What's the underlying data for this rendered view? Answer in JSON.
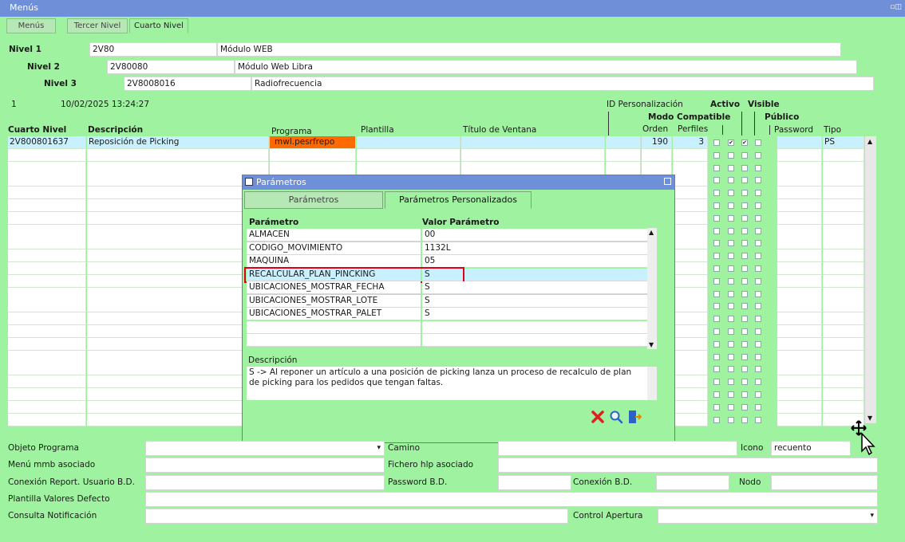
{
  "window": {
    "title": "Menús",
    "controls": "▫◫"
  },
  "tabs": [
    "Menús",
    "Tercer Nivel",
    "Cuarto Nivel"
  ],
  "levels": [
    {
      "label": "Nivel 1",
      "code": "2V80",
      "name": "Módulo WEB"
    },
    {
      "label": "Nivel 2",
      "code": "2V80080",
      "name": "Módulo Web Libra"
    },
    {
      "label": "Nivel 3",
      "code": "2V8008016",
      "name": "Radiofrecuencia"
    }
  ],
  "record": {
    "number": "1",
    "datetime": "10/02/2025 13:24:27"
  },
  "headers": {
    "cuarto_nivel": "Cuarto Nivel",
    "descripcion": "Descripción",
    "programa": "Programa",
    "plantilla": "Plantilla",
    "titulo_ventana": "Título de Ventana",
    "id_personalizacion": "ID Personalización",
    "modo_compatible": "Modo Compatible",
    "orden": "Orden",
    "perfiles": "Perfiles",
    "activo": "Activo",
    "visible": "Visible",
    "publico": "Público",
    "password": "Password",
    "tipo": "Tipo"
  },
  "rows": [
    {
      "cuarto_nivel": "2V800801637",
      "descripcion": "Reposición de Picking",
      "programa": "mwl.pesrfrepo",
      "orden": "190",
      "perfiles": "3",
      "checks": [
        "",
        "✔",
        "✔",
        ""
      ],
      "tipo": "PS"
    }
  ],
  "dialog": {
    "title": "Parámetros",
    "tabs": [
      "Parámetros",
      "Parámetros Personalizados"
    ],
    "col_param": "Parámetro",
    "col_value": "Valor Parámetro",
    "params": [
      {
        "name": "ALMACEN",
        "value": "00"
      },
      {
        "name": "CODIGO_MOVIMIENTO",
        "value": "1132L"
      },
      {
        "name": "MAQUINA",
        "value": "05"
      },
      {
        "name": "RECALCULAR_PLAN_PINCKING",
        "value": "S"
      },
      {
        "name": "UBICACIONES_MOSTRAR_FECHA",
        "value": "S"
      },
      {
        "name": "UBICACIONES_MOSTRAR_LOTE",
        "value": "S"
      },
      {
        "name": "UBICACIONES_MOSTRAR_PALET",
        "value": "S"
      }
    ],
    "selected_index": 3,
    "desc_label": "Descripción",
    "description": "S -> Al reponer un artículo a una posición de picking lanza un proceso de recalculo de plan de picking para los pedidos que tengan faltas."
  },
  "form": {
    "objeto_programa": "Objeto Programa",
    "camino": "Camino",
    "icono": "Icono",
    "icono_value": "recuento",
    "menu_mmb": "Menú mmb asociado",
    "fichero_hlp": "Fichero hlp asociado",
    "conexion_report": "Conexión Report. Usuario B.D.",
    "password_bd": "Password B.D.",
    "conexion_bd": "Conexión B.D.",
    "nodo": "Nodo",
    "plantilla_valores": "Plantilla Valores Defecto",
    "consulta_notificacion": "Consulta Notificación",
    "control_apertura": "Control Apertura"
  },
  "colors": {
    "background": "#9ff29f",
    "titlebar": "#6f8fd8",
    "program_highlight": "#ff6a00",
    "selected_row": "#c8f0ff",
    "highlight_border": "#e0001a"
  }
}
